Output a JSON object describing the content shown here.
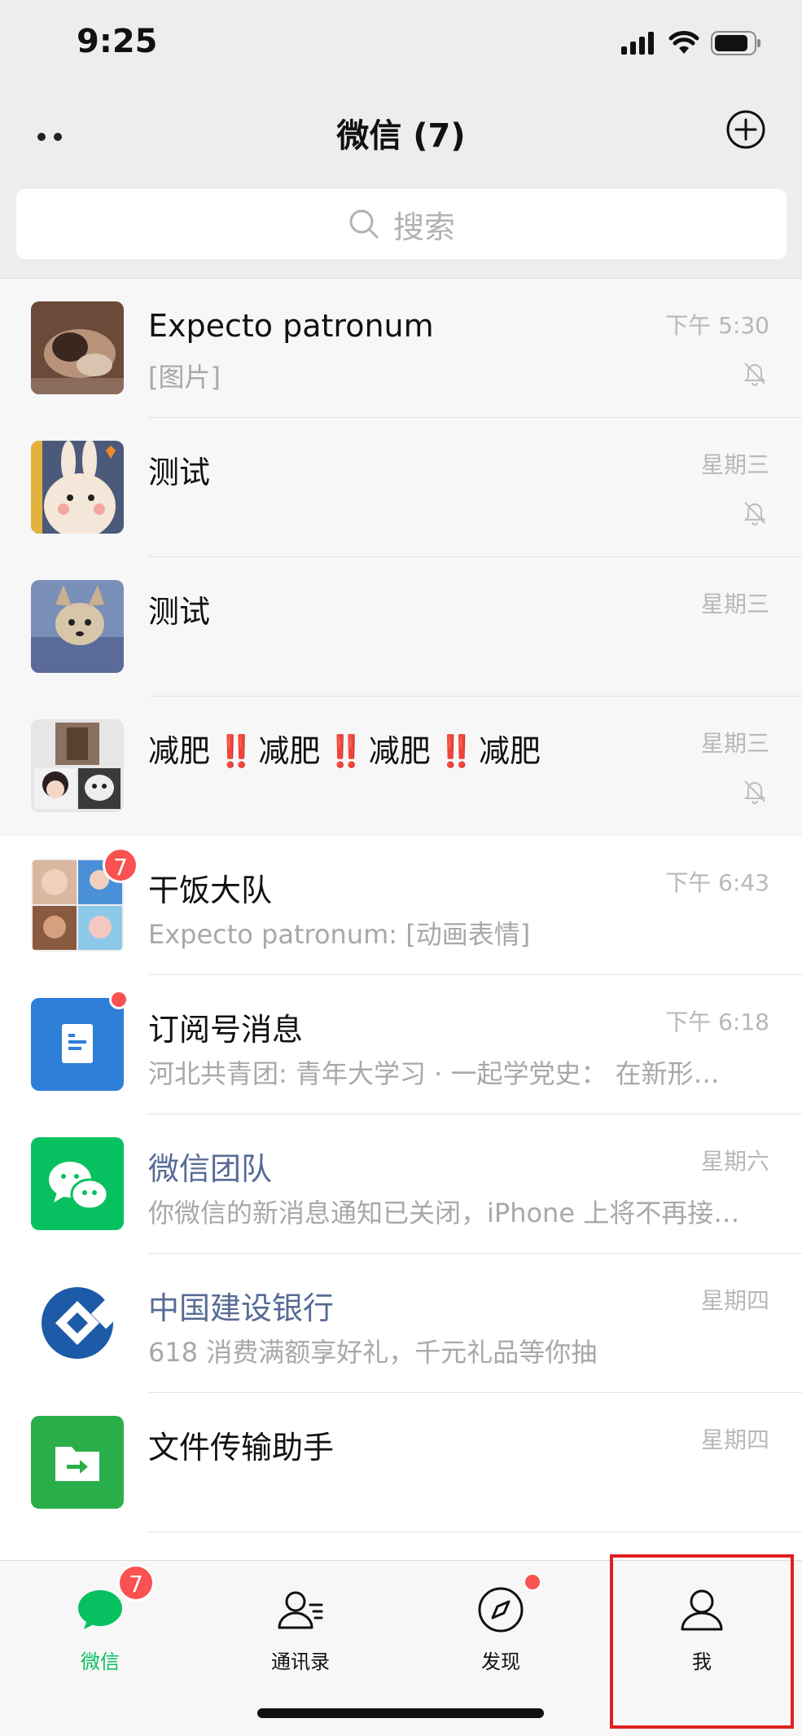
{
  "status_bar": {
    "time": "9:25"
  },
  "nav": {
    "title": "微信 (7)"
  },
  "search": {
    "placeholder": "搜索"
  },
  "chats": [
    {
      "name": "Expecto patronum",
      "preview": "[图片]",
      "time": "下午 5:30",
      "muted": true,
      "pinned": true
    },
    {
      "name": "测试",
      "preview": "",
      "time": "星期三",
      "muted": true,
      "pinned": true
    },
    {
      "name": "测试",
      "preview": "",
      "time": "星期三",
      "muted": false,
      "pinned": true
    },
    {
      "name_parts": [
        "减肥",
        "‼️",
        "减肥",
        "‼️",
        "减肥",
        "‼️",
        "减肥"
      ],
      "preview": "",
      "time": "星期三",
      "muted": true,
      "pinned": true
    },
    {
      "name": "干饭大队",
      "preview": "Expecto patronum: [动画表情]",
      "time": "下午 6:43",
      "badge": "7"
    },
    {
      "name": "订阅号消息",
      "preview": "河北共青团: 青年大学习 · 一起学党史： 在新形…",
      "time": "下午 6:18",
      "dot": true
    },
    {
      "name": "微信团队",
      "preview": "你微信的新消息通知已关闭，iPhone 上将不再接…",
      "time": "星期六",
      "official": true
    },
    {
      "name": "中国建设银行",
      "preview": "618 消费满额享好礼，千元礼品等你抽",
      "time": "星期四",
      "official": true
    },
    {
      "name": "文件传输助手",
      "preview": "",
      "time": "星期四"
    }
  ],
  "tabs": [
    {
      "label": "微信",
      "badge": "7",
      "active": true,
      "icon": "chat-bubble-icon"
    },
    {
      "label": "通讯录",
      "icon": "contacts-icon"
    },
    {
      "label": "发现",
      "icon": "compass-icon",
      "dot": true
    },
    {
      "label": "我",
      "icon": "person-icon"
    }
  ],
  "colors": {
    "accent": "#07c160",
    "badge": "#fa5151",
    "official": "#576b95",
    "highlight": "#e0201f"
  }
}
